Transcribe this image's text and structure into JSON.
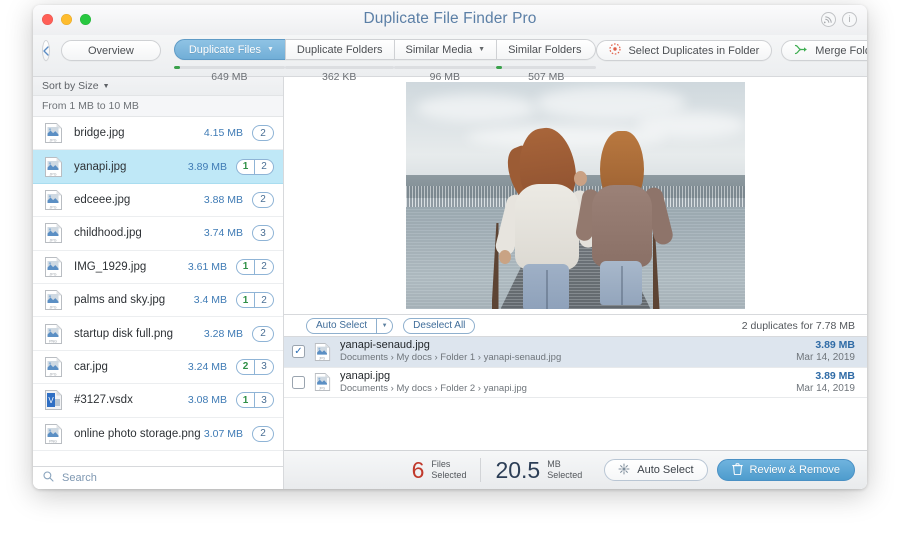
{
  "window": {
    "title": "Duplicate File Finder Pro",
    "title_icons": [
      {
        "name": "rss-icon",
        "glyph": "rss"
      },
      {
        "name": "info-icon",
        "glyph": "i"
      }
    ]
  },
  "toolbar": {
    "back_label": "‹",
    "overview_label": "Overview",
    "tabs": [
      {
        "label": "Duplicate Files",
        "size": "649 MB",
        "active": true,
        "has_caret": true,
        "meter": true
      },
      {
        "label": "Duplicate Folders",
        "size": "362 KB",
        "active": false,
        "has_caret": false,
        "meter": false
      },
      {
        "label": "Similar Media",
        "size": "96 MB",
        "active": false,
        "has_caret": true,
        "meter": false
      },
      {
        "label": "Similar Folders",
        "size": "507 MB",
        "active": false,
        "has_caret": false,
        "meter": true
      }
    ],
    "select_duplicates_label": "Select Duplicates in Folder",
    "merge_folders_label": "Merge Folders"
  },
  "sidebar": {
    "sort_label": "Sort by Size",
    "group_header": "From 1 MB to 10 MB",
    "search_placeholder": "Search",
    "files": [
      {
        "name": "bridge.jpg",
        "size": "4.15 MB",
        "type": "jpg",
        "selected": false,
        "badge": [
          "",
          "2"
        ]
      },
      {
        "name": "yanapi.jpg",
        "size": "3.89 MB",
        "type": "jpg",
        "selected": true,
        "badge": [
          "1",
          "2"
        ]
      },
      {
        "name": "edceee.jpg",
        "size": "3.88 MB",
        "type": "jpg",
        "selected": false,
        "badge": [
          "",
          "2"
        ]
      },
      {
        "name": "childhood.jpg",
        "size": "3.74 MB",
        "type": "jpg",
        "selected": false,
        "badge": [
          "",
          "3"
        ]
      },
      {
        "name": "IMG_1929.jpg",
        "size": "3.61 MB",
        "type": "jpg",
        "selected": false,
        "badge": [
          "1",
          "2"
        ]
      },
      {
        "name": "palms and sky.jpg",
        "size": "3.4 MB",
        "type": "jpg",
        "selected": false,
        "badge": [
          "1",
          "2"
        ]
      },
      {
        "name": "startup disk full.png",
        "size": "3.28 MB",
        "type": "png",
        "selected": false,
        "badge": [
          "",
          "2"
        ]
      },
      {
        "name": "car.jpg",
        "size": "3.24 MB",
        "type": "jpg",
        "selected": false,
        "badge": [
          "2",
          "3"
        ]
      },
      {
        "name": "#3127.vsdx",
        "size": "3.08 MB",
        "type": "vsdx",
        "selected": false,
        "badge": [
          "1",
          "3"
        ]
      },
      {
        "name": "online photo storage.png",
        "size": "3.07 MB",
        "type": "png",
        "selected": false,
        "badge": [
          "",
          "2"
        ]
      }
    ]
  },
  "main": {
    "actionbar": {
      "auto_select_label": "Auto Select",
      "deselect_all_label": "Deselect All",
      "summary": "2 duplicates for 7.78 MB"
    },
    "rows": [
      {
        "checked": true,
        "name": "yanapi-senaud.jpg",
        "path": "Documents › My docs › Folder 1 › yanapi-senaud.jpg",
        "size": "3.89 MB",
        "date": "Mar 14, 2019"
      },
      {
        "checked": false,
        "name": "yanapi.jpg",
        "path": "Documents › My docs › Folder 2 › yanapi.jpg",
        "size": "3.89 MB",
        "date": "Mar 14, 2019"
      }
    ]
  },
  "statusbar": {
    "files_count": "6",
    "files_line1": "Files",
    "files_line2": "Selected",
    "size_value": "20.5",
    "size_line1": "MB",
    "size_line2": "Selected",
    "auto_select_label": "Auto Select",
    "review_remove_label": "Review & Remove"
  },
  "colors": {
    "accent_blue": "#4e9ccd",
    "tab_active": "#71aed7",
    "row_selected": "#bfe8f7",
    "detail_checked": "#dde5ee",
    "size_text": "#3f7bb5",
    "badge_green": "#2f8f46",
    "stat_red": "#c0392b",
    "stat_navy": "#2c3e56",
    "meter_green": "#3aa14b"
  }
}
